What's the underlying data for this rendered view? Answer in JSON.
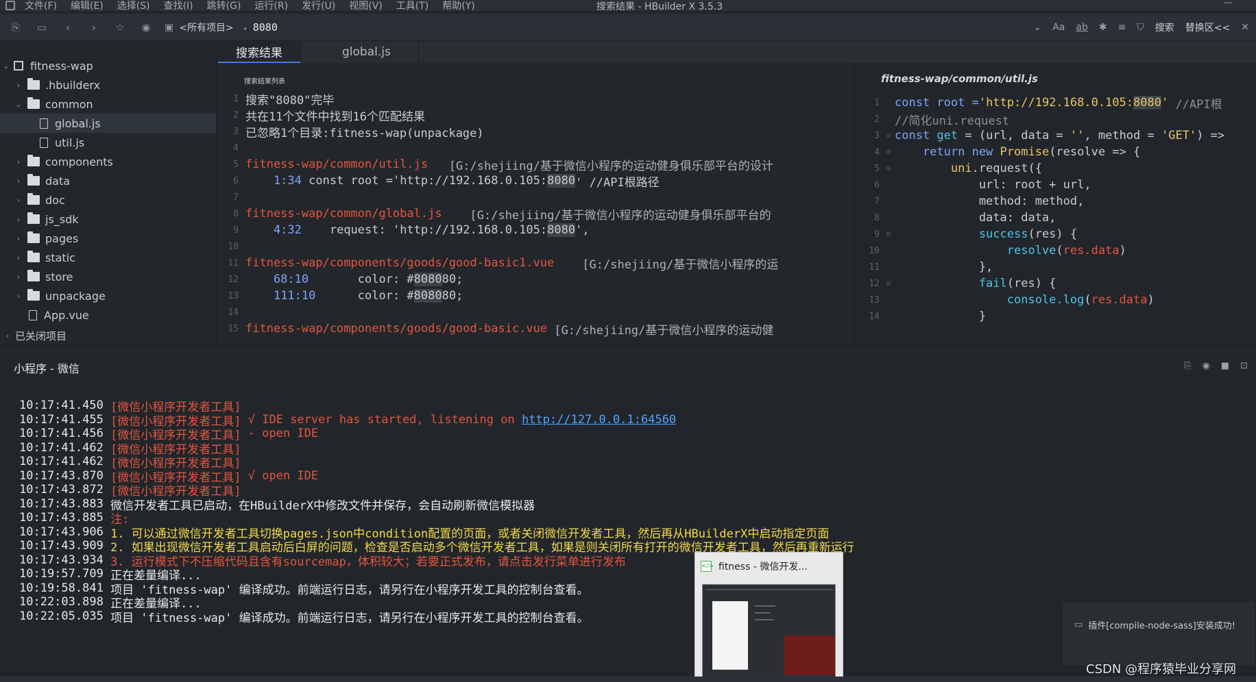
{
  "window": {
    "title": "搜索结果 - HBuilder X 3.5.3",
    "menu": [
      "文件(F)",
      "编辑(E)",
      "选择(S)",
      "查找(I)",
      "跳转(G)",
      "运行(R)",
      "发行(U)",
      "视图(V)",
      "工具(T)",
      "帮助(Y)"
    ],
    "minimize": "—"
  },
  "toolbar": {
    "project_selector": "<所有项目>",
    "search_term": "8080",
    "case_label": "Aa",
    "whole_word_label": "ab",
    "search_label": "搜索",
    "replace_label": "替换区<<"
  },
  "sidebar": {
    "project": "fitness-wap",
    "items": [
      {
        "label": ".hbuilderx",
        "type": "folder",
        "level": 1,
        "expanded": false
      },
      {
        "label": "common",
        "type": "folder",
        "level": 1,
        "expanded": true
      },
      {
        "label": "global.js",
        "type": "file",
        "level": 2,
        "selected": true
      },
      {
        "label": "util.js",
        "type": "file",
        "level": 2
      },
      {
        "label": "components",
        "type": "folder",
        "level": 1
      },
      {
        "label": "data",
        "type": "folder",
        "level": 1
      },
      {
        "label": "doc",
        "type": "folder",
        "level": 1
      },
      {
        "label": "js_sdk",
        "type": "folder",
        "level": 1
      },
      {
        "label": "pages",
        "type": "folder",
        "level": 1
      },
      {
        "label": "static",
        "type": "folder",
        "level": 1
      },
      {
        "label": "store",
        "type": "folder",
        "level": 1
      },
      {
        "label": "unpackage",
        "type": "folder",
        "level": 1
      },
      {
        "label": "App.vue",
        "type": "file",
        "level": 1
      }
    ],
    "closed_projects": "已关闭项目"
  },
  "tabs": [
    "搜索结果",
    "global.js"
  ],
  "results": {
    "title": "搜索结果列表",
    "lines": {
      "l1": "搜索\"8080\"完毕",
      "l2": "共在11个文件中找到16个匹配结果",
      "l3": "已忽略1个目录:fitness-wap(unpackage)",
      "l5_file": "fitness-wap/common/util.js",
      "l5_path": "   [G:/shejiing/基于微信小程序的运动健身俱乐部平台的设计",
      "l6_loc": "1:34",
      "l6_pre": " const root ='http://192.168.0.105:",
      "l6_hit": "8080",
      "l6_post": "' //API根路径",
      "l8_file": "fitness-wap/common/global.js",
      "l8_path": "    [G:/shejiing/基于微信小程序的运动健身俱乐部平台的",
      "l9_loc": "4:32",
      "l9_pre": "    request: 'http://192.168.0.105:",
      "l9_hit": "8080",
      "l9_post": "',",
      "l11_file": "fitness-wap/components/goods/good-basic1.vue",
      "l11_path": "    [G:/shejiing/基于微信小程序的运",
      "l12_loc": "68:10",
      "l12_pre": "       color: #",
      "l12_hit": "8080",
      "l12_post": "80;",
      "l13_loc": "111:10",
      "l13_pre": "      color: #",
      "l13_hit": "8080",
      "l13_post": "80;",
      "l15_file": "fitness-wap/components/goods/good-basic.vue",
      "l15_path": " [G:/shejiing/基于微信小程序的运动健"
    }
  },
  "preview": {
    "title": "fitness-wap/common/util.js",
    "c1a": "const root =",
    "c1b": "'http://192.168.0.105:",
    "c1hit": "8080",
    "c1c": "'",
    "c1d": " //API根",
    "c2": "//简化uni.request",
    "c3a": "const ",
    "c3b": "get",
    "c3c": " = (url, data = ",
    "c3d": "''",
    "c3e": ", method = ",
    "c3f": "'GET'",
    "c3g": ") =>",
    "c4a": "    return new ",
    "c4b": "Promise",
    "c4c": "(resolve => {",
    "c5a": "        uni",
    "c5b": ".request({",
    "c6": "            url: root + url,",
    "c7": "            method: method,",
    "c8": "            data: data,",
    "c9a": "            success",
    "c9b": "(res) {",
    "c10a": "                resolve",
    "c10b": "(",
    "c10c": "res.data",
    "c10d": ")",
    "c11": "            },",
    "c12a": "            fail",
    "c12b": "(res) {",
    "c13a": "                console.log",
    "c13b": "(",
    "c13c": "res.data",
    "c13d": ")",
    "c14": "            }"
  },
  "console": {
    "tab": "小程序 - 微信",
    "lines": [
      {
        "ts": "10:17:41.450",
        "msg": " [微信小程序开发者工具]",
        "color": "red"
      },
      {
        "ts": "10:17:41.455",
        "msg": " [微信小程序开发者工具]",
        "msg2": " √ IDE server has started, listening on ",
        "link": "http://127.0.0.1:64560",
        "color": "red"
      },
      {
        "ts": "10:17:41.456",
        "msg": " [微信小程序开发者工具]",
        "msg2": " - open IDE",
        "color": "red"
      },
      {
        "ts": "10:17:41.462",
        "msg": " [微信小程序开发者工具]",
        "color": "red"
      },
      {
        "ts": "10:17:41.462",
        "msg": " [微信小程序开发者工具]",
        "color": "red"
      },
      {
        "ts": "10:17:43.870",
        "msg": " [微信小程序开发者工具]",
        "msg2": " √ open IDE",
        "color": "red"
      },
      {
        "ts": "10:17:43.872",
        "msg": " [微信小程序开发者工具]",
        "color": "red"
      },
      {
        "ts": "10:17:43.883",
        "msg": " 微信开发者工具已启动，在HBuilderX中修改文件并保存，会自动刷新微信模拟器",
        "color": "white"
      },
      {
        "ts": "10:17:43.885",
        "msg": " 注:",
        "color": "red"
      },
      {
        "ts": "10:17:43.906",
        "msg": " 1. 可以通过微信开发者工具切换pages.json中condition配置的页面，或者关闭微信开发者工具，然后再从HBuilderX中启动指定页面",
        "color": "yellow"
      },
      {
        "ts": "10:17:43.909",
        "msg": " 2. 如果出现微信开发者工具启动后白屏的问题，检查是否启动多个微信开发者工具，如果是则关闭所有打开的微信开发者工具，然后再重新运行",
        "color": "yellow"
      },
      {
        "ts": "10:17:43.934",
        "msg": " 3. 运行模式下不压缩代码且含有sourcemap，体积较大；若要正式发布，请点击发行菜单进行发布",
        "color": "red"
      },
      {
        "ts": "10:19:57.709",
        "msg": " 正在差量编译...",
        "color": "white"
      },
      {
        "ts": "10:19:58.841",
        "msg": " 项目 'fitness-wap' 编译成功。前端运行日志，请另行在小程序开发工具的控制台查看。",
        "color": "white"
      },
      {
        "ts": "10:22:03.898",
        "msg": " 正在差量编译...",
        "color": "white"
      },
      {
        "ts": "10:22:05.035",
        "msg": " 项目 'fitness-wap' 编译成功。前端运行日志，请另行在小程序开发工具的控制台查看。",
        "color": "white"
      }
    ]
  },
  "thumbnail": {
    "title": "fitness - 微信开发..."
  },
  "toast": {
    "text": "插件[compile-node-sass]安装成功!"
  },
  "watermark": "CSDN @程序猿毕业分享网"
}
